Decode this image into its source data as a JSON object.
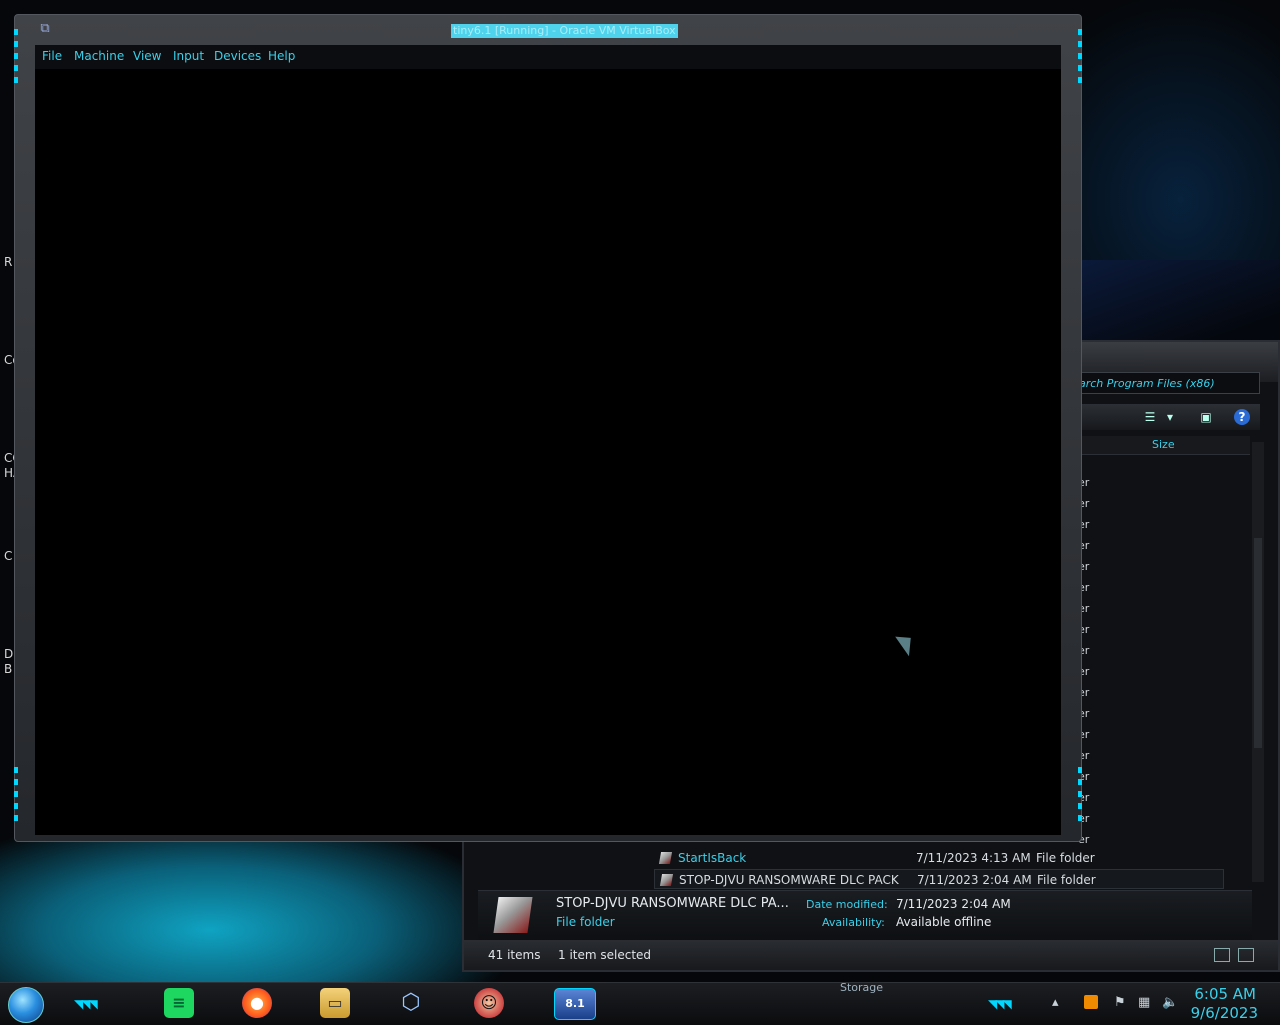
{
  "desktop": {
    "edge_texts": [
      "R",
      "Co",
      "CC",
      "HA",
      "C",
      "D",
      "B"
    ]
  },
  "vbox": {
    "title": "tiny6.1 [Running] - Oracle VM VirtualBox",
    "menu": [
      "File",
      "Machine",
      "View",
      "Input",
      "Devices",
      "Help"
    ]
  },
  "explorer": {
    "search_placeholder": "arch Program Files (x86)",
    "column_size": "Size",
    "type_fragment": "er",
    "rows": [
      {
        "name": "StartIsBack",
        "date": "7/11/2023 4:13 AM",
        "type": "File folder"
      },
      {
        "name": "STOP-DJVU RANSOMWARE DLC PACK",
        "date": "7/11/2023 2:04 AM",
        "type": "File folder"
      }
    ],
    "details": {
      "name": "STOP-DJVU RANSOMWARE DLC PA...",
      "kind": "File folder",
      "date_modified_label": "Date modified:",
      "date_modified_value": "7/11/2023 2:04 AM",
      "availability_label": "Availability:",
      "availability_value": "Available offline"
    },
    "status": {
      "count": "41 items",
      "selected": "1 item selected"
    }
  },
  "taskbar": {
    "hidden_label": "Storage",
    "clock_time": "6:05 AM",
    "clock_date": "9/6/2023",
    "eight_label": "8.1"
  },
  "colors": {
    "accent": "#3ad0ea",
    "frame": "#2a2e34",
    "background": "#05070a"
  }
}
